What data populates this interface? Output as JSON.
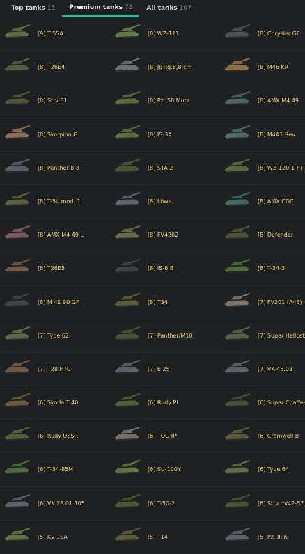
{
  "tabs": [
    {
      "label": "Top tanks",
      "count": "15",
      "active": false
    },
    {
      "label": "Premium tanks",
      "count": "73",
      "active": true
    },
    {
      "label": "All tanks",
      "count": "107",
      "active": false
    }
  ],
  "tanks": [
    {
      "name": "[9] T 55A",
      "color": "#5d6b46"
    },
    {
      "name": "[8] WZ-111",
      "color": "#5f7a45"
    },
    {
      "name": "[8] Chrysler GF",
      "color": "#4e5152"
    },
    {
      "name": "[8] T26E4",
      "color": "#575a3e"
    },
    {
      "name": "[8] JgTig.8,8 cm",
      "color": "#6a6e72"
    },
    {
      "name": "[8] M46 KR",
      "color": "#8d6f44"
    },
    {
      "name": "[8] Strv S1",
      "color": "#4f5536"
    },
    {
      "name": "[8] Pz. 58 Mutz",
      "color": "#5c6a3c"
    },
    {
      "name": "[8] AMX M4 49",
      "color": "#4c6662"
    },
    {
      "name": "[8] Skorpion G",
      "color": "#8a6d57"
    },
    {
      "name": "[8] IS-3A",
      "color": "#5a6d3c"
    },
    {
      "name": "[8] M4A1 Rev.",
      "color": "#4f6a66"
    },
    {
      "name": "[8] Panther 8,8",
      "color": "#585e66"
    },
    {
      "name": "[8] STA-2",
      "color": "#4b5438"
    },
    {
      "name": "[8] WZ-120-1 FT",
      "color": "#55683d"
    },
    {
      "name": "[8] T-54 mod. 1",
      "color": "#5a6040"
    },
    {
      "name": "[8] Löwe",
      "color": "#5d6470"
    },
    {
      "name": "[8] AMX CDC",
      "color": "#3f6a64"
    },
    {
      "name": "[8] AMX M4 49 L",
      "color": "#7a5a5e"
    },
    {
      "name": "[8] FV4202",
      "color": "#6c6a4a"
    },
    {
      "name": "[8] Defender",
      "color": "#4d5236"
    },
    {
      "name": "[8] T26E5",
      "color": "#6e5a4a"
    },
    {
      "name": "[8] IS-6 B",
      "color": "#3f4346"
    },
    {
      "name": "[8] T-34-3",
      "color": "#4e6a3e"
    },
    {
      "name": "[8] M 41 90 GF",
      "color": "#3f4346"
    },
    {
      "name": "[8] T34",
      "color": "#5a5c3a"
    },
    {
      "name": "[7] FV201 (A45)",
      "color": "#7d746a"
    },
    {
      "name": "[7] Type 62",
      "color": "#5b6a44"
    },
    {
      "name": "[7] Panther/M10",
      "color": "#4a5034"
    },
    {
      "name": "[7] Super Hellcat",
      "color": "#5a5e44"
    },
    {
      "name": "[7] T28 HTC",
      "color": "#6d5746"
    },
    {
      "name": "[7] E 25",
      "color": "#5a6068"
    },
    {
      "name": "[7] VK 45.03",
      "color": "#5c6068"
    },
    {
      "name": "[6] Skoda T 40",
      "color": "#6a5a3c"
    },
    {
      "name": "[6] Rudy Pl",
      "color": "#4e6238"
    },
    {
      "name": "[6] Super Chaffee",
      "color": "#4a4f3a"
    },
    {
      "name": "[6] Rudy USSR",
      "color": "#4e6238"
    },
    {
      "name": "[6] TOG II*",
      "color": "#75706a"
    },
    {
      "name": "[6] Cromwell B",
      "color": "#5a5c3c"
    },
    {
      "name": "[6] T-34-85M",
      "color": "#4e6a3e"
    },
    {
      "name": "[6] SU-100Y",
      "color": "#5e7446"
    },
    {
      "name": "[6] Type 64",
      "color": "#5a6c48"
    },
    {
      "name": "[6] VK 28.01 105",
      "color": "#5c6068"
    },
    {
      "name": "[6] T-50-2",
      "color": "#505536"
    },
    {
      "name": "[6] Strv m/42-57",
      "color": "#4d5236"
    },
    {
      "name": "[5] KV-1SA",
      "color": "#5e7446"
    },
    {
      "name": "[5] T14",
      "color": "#5a5c3a"
    },
    {
      "name": "[5] Pz. III K",
      "color": "#5c6068"
    }
  ]
}
